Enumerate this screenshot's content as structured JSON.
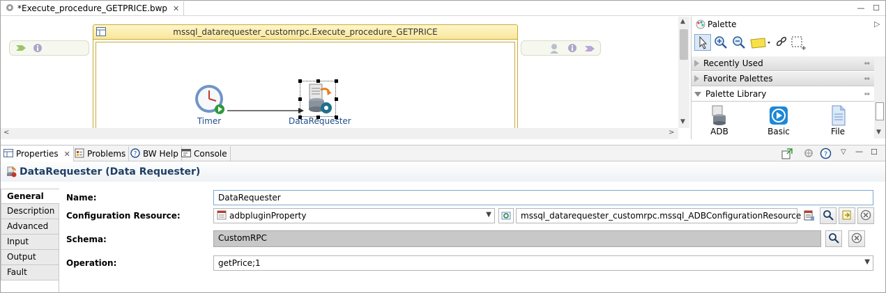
{
  "editor": {
    "tab_title": "*Execute_procedure_GETPRICE.bwp",
    "process_group_title": "mssql_datarequester_customrpc.Execute_procedure_GETPRICE",
    "activities": [
      {
        "label": "Timer",
        "icon": "timer-icon"
      },
      {
        "label": "DataRequester",
        "icon": "datarequester-icon"
      }
    ]
  },
  "palette": {
    "title": "Palette",
    "drawers": [
      {
        "label": "Recently Used",
        "expanded": false
      },
      {
        "label": "Favorite Palettes",
        "expanded": false
      },
      {
        "label": "Palette Library",
        "expanded": true
      }
    ],
    "items": [
      {
        "label": "ADB",
        "icon": "database-icon"
      },
      {
        "label": "Basic",
        "icon": "play-circle-icon"
      },
      {
        "label": "File",
        "icon": "file-icon"
      }
    ]
  },
  "view_tabs": [
    {
      "label": "Properties",
      "active": true,
      "icon": "properties-icon"
    },
    {
      "label": "Problems",
      "active": false,
      "icon": "problems-icon"
    },
    {
      "label": "BW Help",
      "active": false,
      "icon": "help-icon"
    },
    {
      "label": "Console",
      "active": false,
      "icon": "console-icon"
    }
  ],
  "properties": {
    "title": "DataRequester (Data Requester)",
    "side_tabs": [
      "General",
      "Description",
      "Advanced",
      "Input",
      "Output",
      "Fault"
    ],
    "active_side_tab": "General",
    "fields": {
      "name": {
        "label": "Name:",
        "value": "DataRequester"
      },
      "config": {
        "label": "Configuration Resource:",
        "value": "adbpluginProperty",
        "resource_path": "mssql_datarequester_customrpc.mssql_ADBConfigurationResource"
      },
      "schema": {
        "label": "Schema:",
        "value": "CustomRPC"
      },
      "operation": {
        "label": "Operation:",
        "value": "getPrice;1"
      }
    }
  },
  "colors": {
    "group_border": "#c7a93a",
    "group_header": "#f8e79a",
    "title_blue": "#1e3e64",
    "activity_label": "#1f4e8c"
  }
}
